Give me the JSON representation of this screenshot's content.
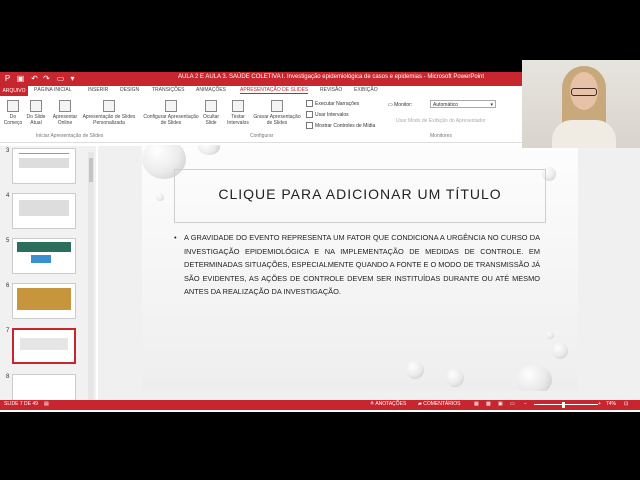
{
  "window": {
    "title": "AULA 2 E AULA 3. SAÚDE COLETIVA I. Investigação epidemiológica de casos e epidemias - Microsoft PowerPoint"
  },
  "tabs": [
    {
      "label": "ARQUIVO"
    },
    {
      "label": "PÁGINA INICIAL"
    },
    {
      "label": "INSERIR"
    },
    {
      "label": "DESIGN"
    },
    {
      "label": "TRANSIÇÕES"
    },
    {
      "label": "ANIMAÇÕES"
    },
    {
      "label": "APRESENTAÇÃO DE SLIDES"
    },
    {
      "label": "REVISÃO"
    },
    {
      "label": "EXIBIÇÃO"
    }
  ],
  "ribbon": {
    "buttons": [
      {
        "label": "Do Começo"
      },
      {
        "label": "Do Slide Atual"
      },
      {
        "label": "Apresentar Online"
      },
      {
        "label": "Apresentação de Slides Personalizada"
      },
      {
        "label": "Configurar Apresentação de Slides"
      },
      {
        "label": "Ocultar Slide"
      },
      {
        "label": "Testar Intervalos"
      },
      {
        "label": "Gravar Apresentação de Slides"
      }
    ],
    "checks": [
      {
        "label": "Executar Narrações",
        "checked": true
      },
      {
        "label": "Usar Intervalos",
        "checked": false
      },
      {
        "label": "Mostrar Controles de Mídia",
        "checked": true
      }
    ],
    "monitor_label": "Monitor:",
    "monitor_value": "Automático",
    "presenter_view": "Usar Modo de Exibição do Apresentador",
    "groups": {
      "start": "Iniciar Apresentação de Slides",
      "setup": "Configurar",
      "monitors": "Monitores"
    }
  },
  "thumbnails": [
    {
      "number": "3"
    },
    {
      "number": "4"
    },
    {
      "number": "5"
    },
    {
      "number": "6"
    },
    {
      "number": "7"
    },
    {
      "number": "8"
    }
  ],
  "slide": {
    "title_placeholder": "Clique para adicionar um título",
    "bullet": "A gravidade do evento representa um fator que condiciona a urgência no curso da investigação epidemiológica e na implementação de medidas de controle. Em determinadas situações, especialmente quando a fonte e o modo de transmissão já são evidentes, as ações de controle devem ser instituídas durante ou até mesmo antes da realização da investigação."
  },
  "status": {
    "slide_counter": "SLIDE 7 DE 49",
    "notes": "ANOTAÇÕES",
    "comments": "COMENTÁRIOS",
    "zoom": "74%"
  },
  "colors": {
    "accent": "#c8262e"
  }
}
